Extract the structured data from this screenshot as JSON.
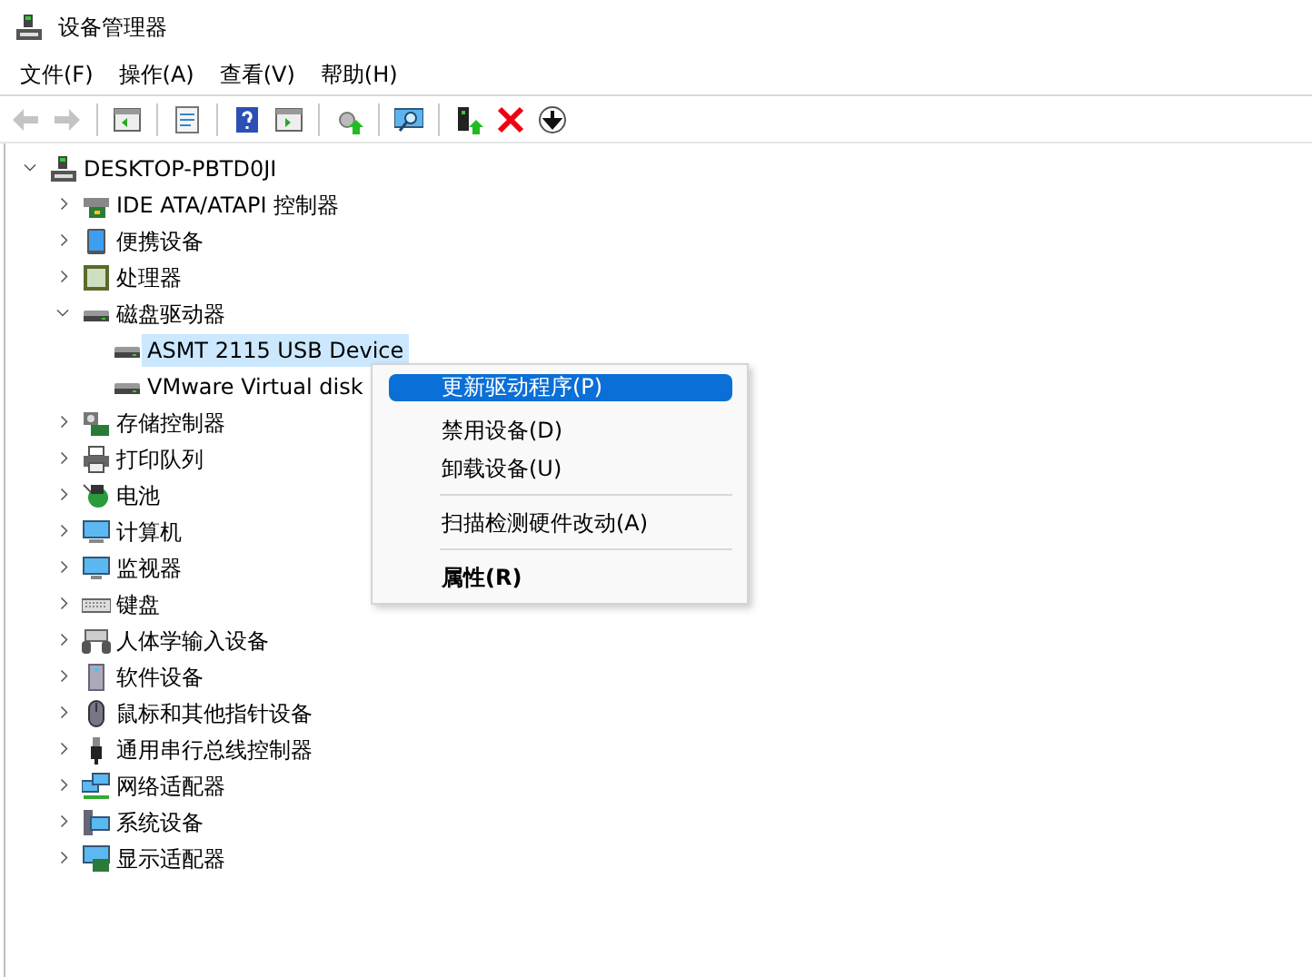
{
  "window": {
    "title": "设备管理器"
  },
  "menu_bar": [
    "文件(F)",
    "操作(A)",
    "查看(V)",
    "帮助(H)"
  ],
  "toolbar": [
    {
      "disabled": true
    },
    {
      "disabled": true
    },
    {
      "kind": "separator"
    },
    {
      "disabled": false
    },
    {
      "kind": "separator"
    },
    {
      "disabled": false
    },
    {
      "kind": "separator"
    },
    {
      "disabled": false
    },
    {
      "disabled": false
    },
    {
      "kind": "separator"
    },
    {
      "disabled": false
    },
    {
      "kind": "separator"
    },
    {
      "disabled": false
    },
    {
      "kind": "separator"
    },
    {
      "disabled": false
    },
    {
      "disabled": false
    },
    {
      "disabled": false
    }
  ],
  "tree": {
    "label": "DESKTOP-PBTD0JI",
    "expanded": true,
    "children": [
      {
        "label": "IDE ATA/ATAPI 控制器",
        "expanded": false
      },
      {
        "label": "便携设备",
        "expanded": false
      },
      {
        "label": "处理器",
        "expanded": false
      },
      {
        "label": "磁盘驱动器",
        "expanded": true,
        "children": [
          {
            "label": "ASMT 2115 USB Device",
            "selected": true
          },
          {
            "label": "VMware Virtual disk",
            "selected": false
          }
        ]
      },
      {
        "label": "存储控制器",
        "expanded": false
      },
      {
        "label": "打印队列",
        "expanded": false
      },
      {
        "label": "电池",
        "expanded": false
      },
      {
        "label": "计算机",
        "expanded": false
      },
      {
        "label": "监视器",
        "expanded": false
      },
      {
        "label": "键盘",
        "expanded": false
      },
      {
        "label": "人体学输入设备",
        "expanded": false
      },
      {
        "label": "软件设备",
        "expanded": false
      },
      {
        "label": "鼠标和其他指针设备",
        "expanded": false
      },
      {
        "label": "通用串行总线控制器",
        "expanded": false
      },
      {
        "label": "网络适配器",
        "expanded": false
      },
      {
        "label": "系统设备",
        "expanded": false
      },
      {
        "label": "显示适配器",
        "expanded": false
      }
    ]
  },
  "context_menu": [
    {
      "kind": "item",
      "label": "更新驱动程序(P)",
      "selected": true,
      "default": false
    },
    {
      "kind": "item",
      "label": "禁用设备(D)",
      "selected": false,
      "default": false
    },
    {
      "kind": "item",
      "label": "卸载设备(U)",
      "selected": false,
      "default": false
    },
    {
      "kind": "separator"
    },
    {
      "kind": "item",
      "label": "扫描检测硬件改动(A)",
      "selected": false,
      "default": false
    },
    {
      "kind": "separator"
    },
    {
      "kind": "item",
      "label": "属性(R)",
      "selected": false,
      "default": true
    }
  ]
}
